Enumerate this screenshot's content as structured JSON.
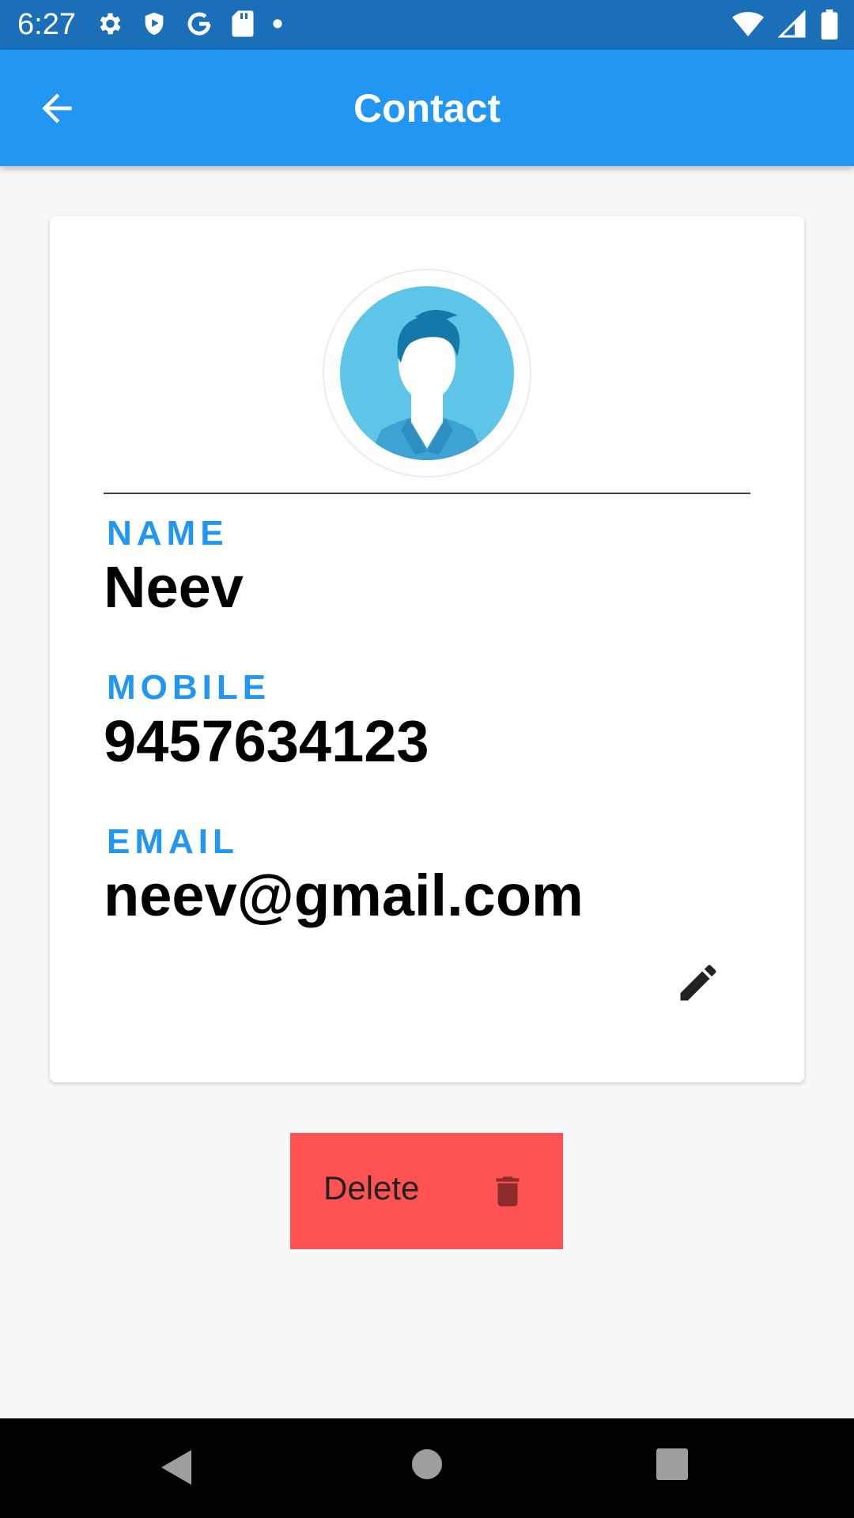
{
  "status_bar": {
    "time": "6:27",
    "left_icons": [
      "gear-icon",
      "shield-play-icon",
      "google-icon",
      "sd-card-icon",
      "dot-icon"
    ],
    "right_icons": [
      "wifi-icon",
      "signal-icon",
      "battery-icon"
    ]
  },
  "app_bar": {
    "title": "Contact",
    "back_icon": "arrow-left-icon"
  },
  "contact": {
    "name_label": "NAME",
    "name_value": "Neev",
    "mobile_label": "MOBILE",
    "mobile_value": "9457634123",
    "email_label": "EMAIL",
    "email_value": "neev@gmail.com"
  },
  "actions": {
    "delete_label": "Delete"
  },
  "colors": {
    "status_bar": "#1b6fb8",
    "app_bar": "#2196f3",
    "label": "#2196f3",
    "delete_bg": "#ff5252",
    "delete_icon": "#8b2b2b"
  }
}
